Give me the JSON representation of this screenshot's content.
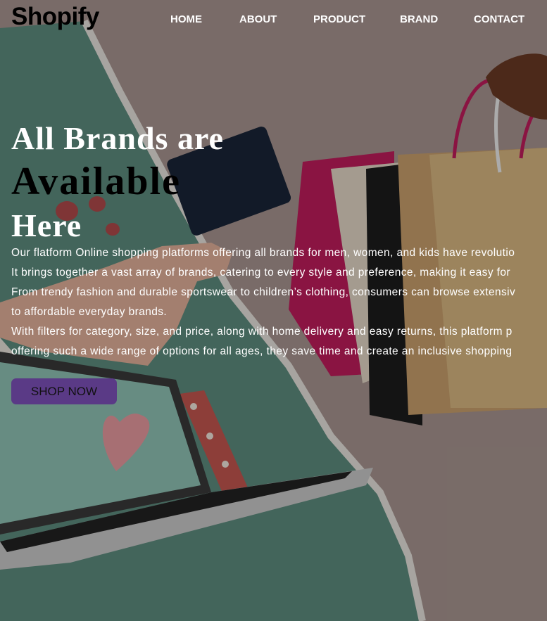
{
  "brand": {
    "logo": "Shopify"
  },
  "nav": {
    "items": [
      "HOME",
      "ABOUT",
      "PRODUCT",
      "BRAND",
      "CONTACT"
    ]
  },
  "hero": {
    "heading_line1": "All Brands are",
    "heading_line2": "Available",
    "heading_line3": "Here",
    "paragraph_lines": [
      "Our flatform Online shopping platforms offering all brands for men, women, and kids have revolutio",
      "It brings together a vast array of brands, catering to every style and preference, making it easy for",
      "From trendy fashion and durable sportswear to children’s clothing, consumers can browse extensiv",
      "to affordable everyday brands.",
      "With filters for category, size, and price, along with home delivery and easy returns, this platform p",
      "offering such a wide range of options for all ages, they save time and create an inclusive shopping"
    ],
    "cta_label": "SHOP NOW"
  },
  "colors": {
    "nav_text": "#ffffff",
    "cta_background": "#5a3a86",
    "background": "#857470"
  }
}
